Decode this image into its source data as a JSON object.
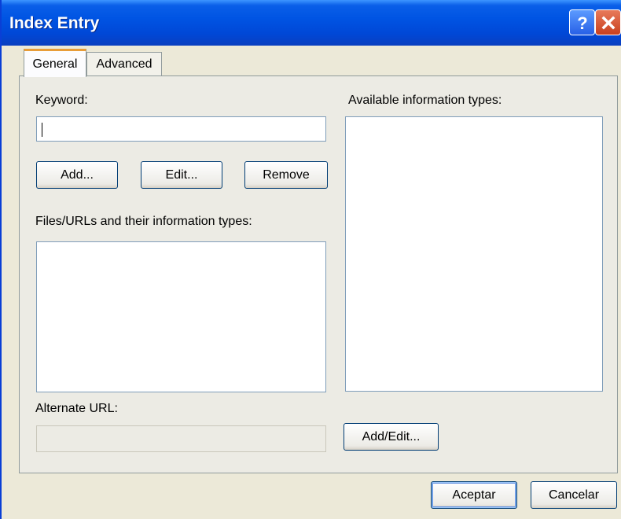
{
  "window": {
    "title": "Index Entry"
  },
  "titlebar": {
    "help_icon": "help-icon",
    "close_icon": "close-icon"
  },
  "tabs": [
    {
      "label": "General",
      "selected": true
    },
    {
      "label": "Advanced",
      "selected": false
    }
  ],
  "general": {
    "keyword_label": "Keyword:",
    "keyword_value": "",
    "add_button": "Add...",
    "edit_button": "Edit...",
    "remove_button": "Remove",
    "files_label": "Files/URLs and their information types:",
    "available_label": "Available information types:",
    "alternate_label": "Alternate URL:",
    "alternate_value": "",
    "add_edit_button": "Add/Edit..."
  },
  "footer": {
    "ok_button": "Aceptar",
    "cancel_button": "Cancelar"
  }
}
